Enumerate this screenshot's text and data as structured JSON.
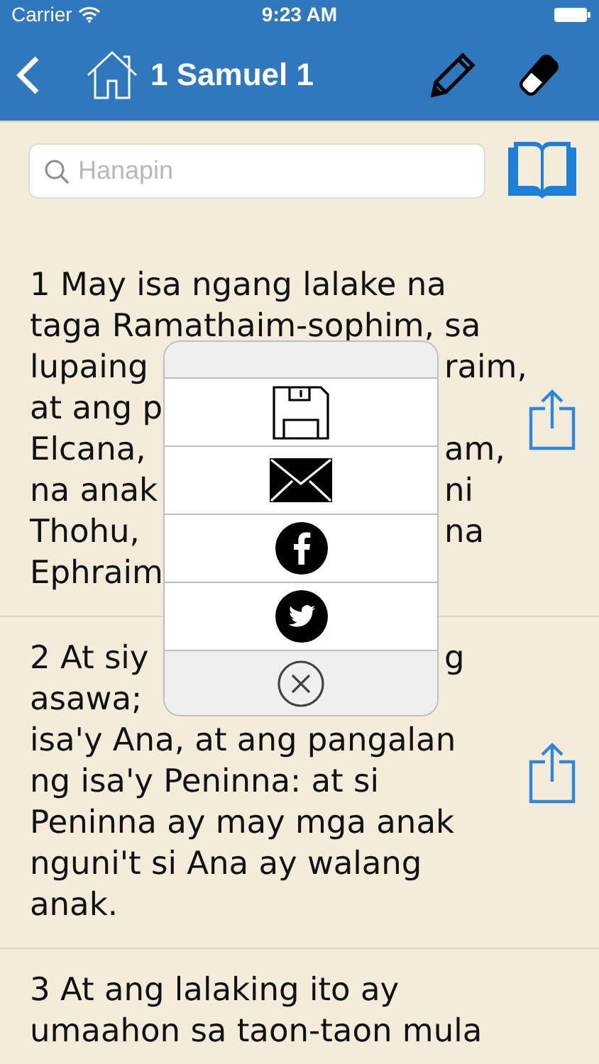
{
  "status_bar": {
    "carrier": "Carrier",
    "time": "9:23 AM"
  },
  "nav": {
    "title": "1 Samuel 1"
  },
  "search": {
    "placeholder": "Hanapin"
  },
  "verses": [
    {
      "lines": [
        {
          "text": "1 May isa ngang lalake na"
        },
        {
          "text": "taga Ramathaim-sophim, sa"
        },
        {
          "left": "lupaing",
          "right": "raim,"
        },
        {
          "left": "at ang p"
        },
        {
          "left": "Elcana,",
          "right": "am,"
        },
        {
          "left": "na anak",
          "right": "ni"
        },
        {
          "left": "Thohu,",
          "right": "na"
        },
        {
          "left": "Ephraim"
        }
      ]
    },
    {
      "lines": [
        {
          "left": "2 At siy",
          "right": "g"
        },
        {
          "left": "asawa;"
        },
        {
          "text": "isa'y Ana, at ang pangalan"
        },
        {
          "text": "ng isa'y Peninna: at si"
        },
        {
          "text": "Peninna ay may mga anak"
        },
        {
          "text": "nguni't si Ana ay walang"
        },
        {
          "text": "anak."
        }
      ]
    },
    {
      "lines": [
        {
          "text": "3 At ang lalaking ito ay"
        },
        {
          "text": "umaahon sa taon-taon mula"
        }
      ]
    }
  ]
}
